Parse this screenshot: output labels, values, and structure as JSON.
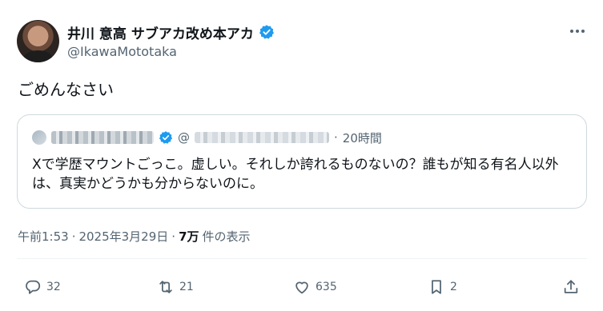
{
  "author": {
    "display_name": "井川 意高 サブアカ改め本アカ",
    "handle": "@IkawaMototaka",
    "verified": true
  },
  "tweet": {
    "text": "ごめんなさい"
  },
  "quoted_tweet": {
    "handle_prefix": "@",
    "separator": "·",
    "time": "20時間",
    "text": "Xで学歴マウントごっこ。虚しい。それしか誇れるものないの？誰もが知る有名人以外は、真実かどうかも分からないのに。"
  },
  "meta": {
    "time": "午前1:53",
    "separator": "·",
    "date": "2025年3月29日",
    "separator2": "·",
    "views": "7万",
    "views_label": "件の表示"
  },
  "actions": {
    "replies": "32",
    "reposts": "21",
    "likes": "635",
    "bookmarks": "2"
  },
  "colors": {
    "verified_blue": "#1d9bf0",
    "muted_text": "#536471",
    "border": "#cfd9de"
  }
}
